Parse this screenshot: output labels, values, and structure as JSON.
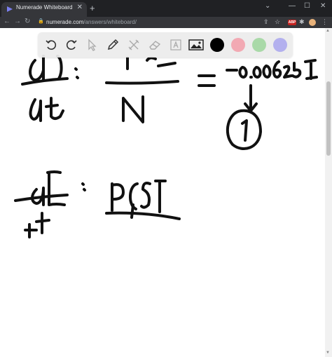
{
  "browser": {
    "tab_title": "Numerade Whiteboard",
    "url_host": "numerade.com",
    "url_path": "/answers/whiteboard/",
    "extension_badge": "ABP"
  },
  "palette": {
    "colors": [
      "#000000",
      "#f2a9b3",
      "#a9d9a8",
      "#b3b0ee"
    ]
  },
  "icons": [
    "undo-icon",
    "redo-icon",
    "pointer-icon",
    "pen-icon",
    "tools-icon",
    "eraser-icon",
    "text-icon",
    "image-icon"
  ]
}
